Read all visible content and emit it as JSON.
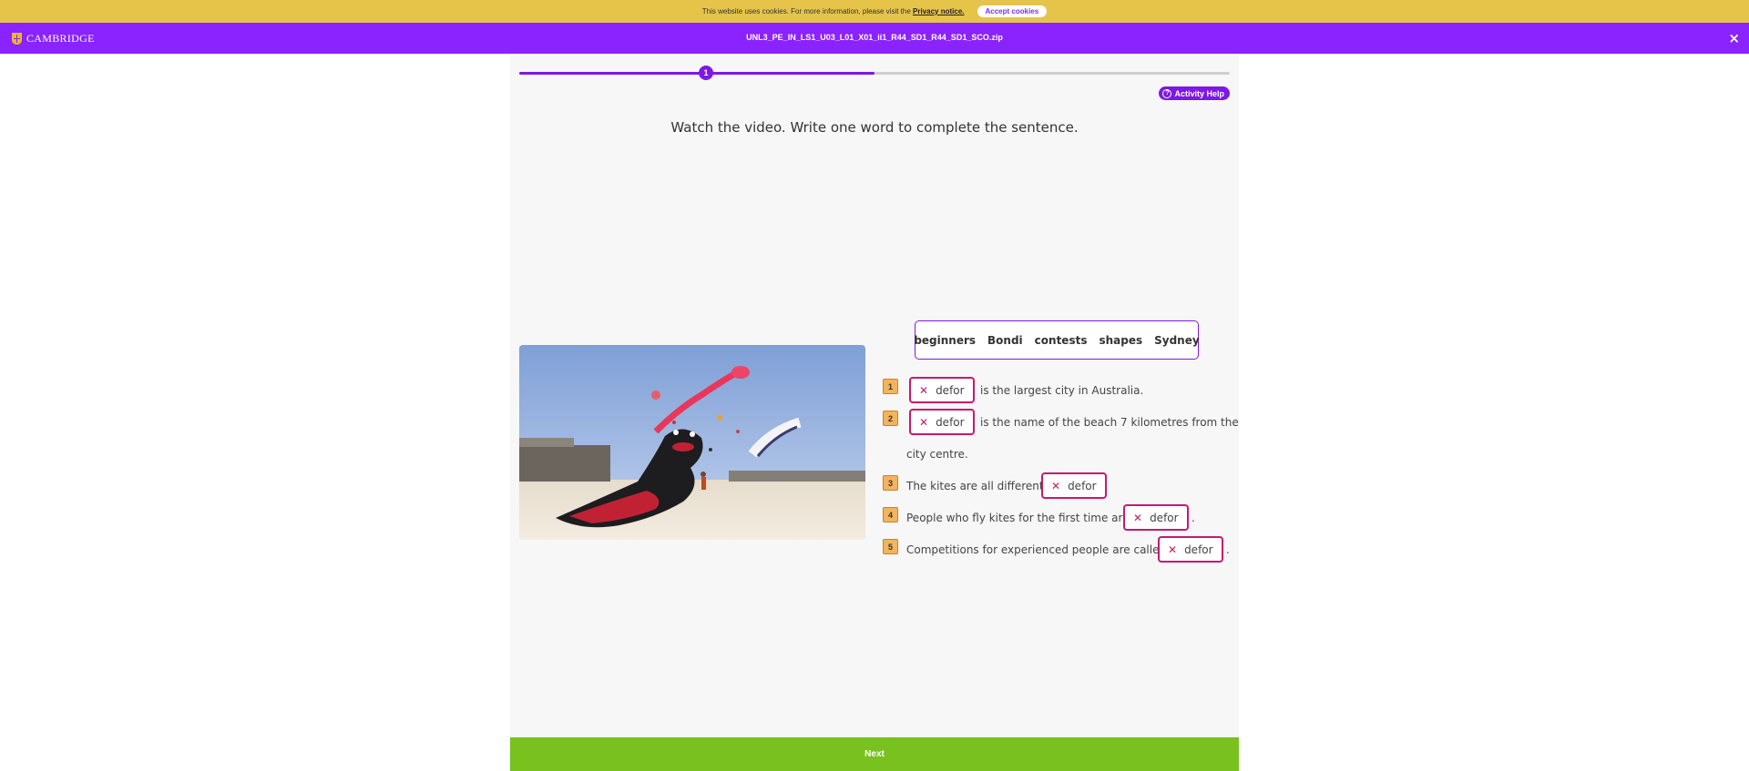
{
  "cookie": {
    "message": "This website uses cookies. For more information, please visit the",
    "link": "Privacy notice.",
    "accept": "Accept cookies"
  },
  "header": {
    "logo": "CAMBRIDGE",
    "file_name": "UNL3_PE_IN_LS1_U03_L01_X01_ii1_R44_SD1_R44_SD1_SCO.zip",
    "close": "×"
  },
  "progress": {
    "current_step": "1",
    "fraction": 0.5
  },
  "help": {
    "label": "Activity Help",
    "icon": "question-icon"
  },
  "instruction": "Watch the video. Write one word to complete the sentence.",
  "word_bank": [
    "beginners",
    "Bondi",
    "contests",
    "shapes",
    "Sydney"
  ],
  "questions": [
    {
      "num": "1",
      "answer": "defor",
      "before": "",
      "after": "is the largest city in Australia."
    },
    {
      "num": "2",
      "answer": "defor",
      "before": "",
      "after": "is the name of the beach 7 kilometres from the",
      "after2": "city centre."
    },
    {
      "num": "3",
      "answer": "defor",
      "before": "The kites are all different",
      "after": ""
    },
    {
      "num": "4",
      "answer": "defor",
      "before": "People who fly kites for the first time are",
      "after": "."
    },
    {
      "num": "5",
      "answer": "defor",
      "before": "Competitions for experienced people are called",
      "after": "."
    }
  ],
  "answer_status_icon": "cross-icon",
  "next": "Next"
}
